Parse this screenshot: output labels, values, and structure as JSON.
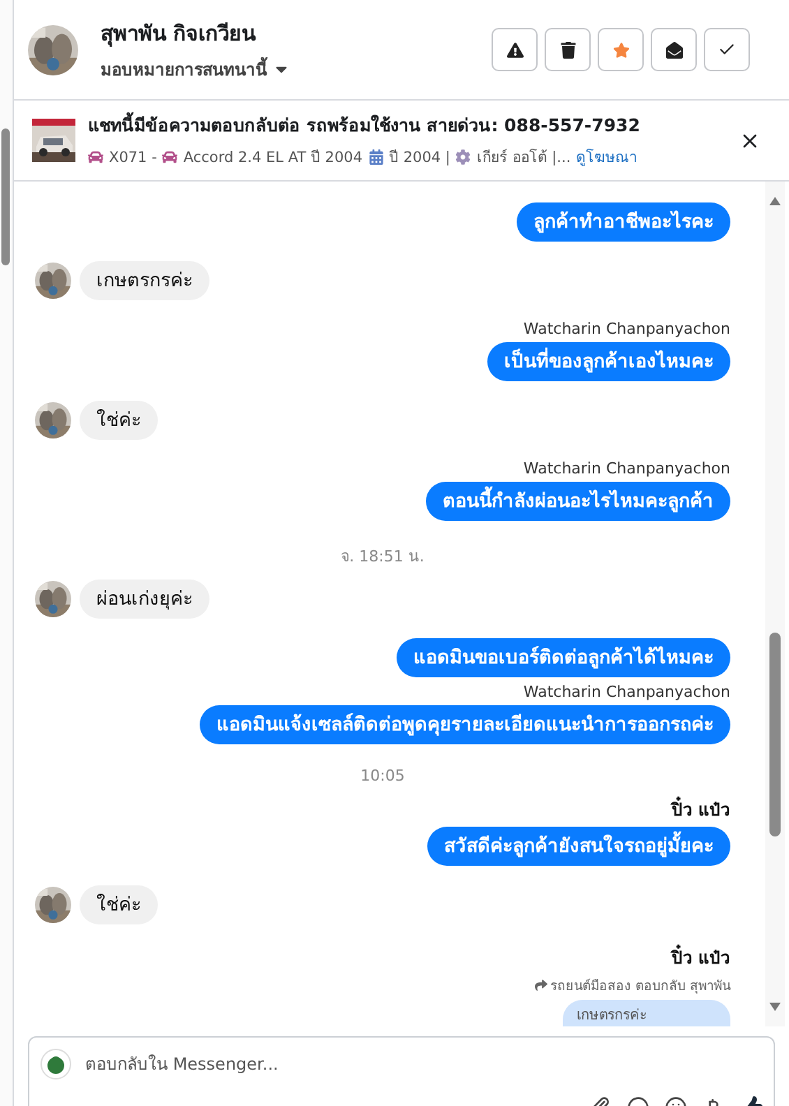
{
  "contact": {
    "name": "สุพาพัน กิจเกวียน",
    "assign_label": "มอบหมายการสนทนานี้"
  },
  "actions": [
    {
      "kind": "spam"
    },
    {
      "kind": "delete"
    },
    {
      "kind": "star",
      "on": true
    },
    {
      "kind": "unread"
    },
    {
      "kind": "done"
    }
  ],
  "ad_banner": {
    "title": "แชทนี้มีข้อความตอบกลับต่อ รถพร้อมใช้งาน สายด่วน: 088-557-7932",
    "details": [
      {
        "kind": "car",
        "text": "X071 -"
      },
      {
        "kind": "car",
        "text": "Accord 2.4 EL AT ปี 2004"
      },
      {
        "kind": "calendar",
        "text": "ปี 2004 |"
      },
      {
        "kind": "gear",
        "text": "เกียร์ ออโต้ |..."
      }
    ],
    "link": "ดูโฆษณา"
  },
  "messages": [
    {
      "kind": "out",
      "text": "ลูกค้าทำอาชีพอะไรคะ"
    },
    {
      "kind": "in",
      "text": "เกษตรกรค่ะ"
    },
    {
      "kind": "out",
      "sender": "Watcharin Chanpanyachon",
      "text": "เป็นที่ของลูกค้าเองไหมคะ"
    },
    {
      "kind": "in",
      "text": "ใช่ค่ะ"
    },
    {
      "kind": "out",
      "sender": "Watcharin Chanpanyachon",
      "text": "ตอนนี้กำลังผ่อนอะไรไหมคะลูกค้า"
    },
    {
      "kind": "time",
      "text": "จ. 18:51 น."
    },
    {
      "kind": "in",
      "text": "ผ่อนเก่งยุค่ะ"
    },
    {
      "kind": "out",
      "text": "แอดมินขอเบอร์ติดต่อลูกค้าได้ไหมคะ"
    },
    {
      "kind": "out",
      "sender": "Watcharin Chanpanyachon",
      "text": "แอดมินแจ้งเซลล์ติดต่อพูดคุยรายละเอียดแนะนำการออกรถค่ะ"
    },
    {
      "kind": "time",
      "text": "10:05"
    },
    {
      "kind": "out",
      "sender": "ปิ๋ว แป๋ว",
      "sender_bold": true,
      "text": "สวัสดีค่ะลูกค้ายังสนใจรถอยู่มั้ยคะ"
    },
    {
      "kind": "in",
      "text": "ใช่ค่ะ"
    },
    {
      "kind": "reply",
      "sender": "ปิ๋ว แป๋ว",
      "sender_bold": true,
      "note": "รถยนต์มือสอง ตอบกลับ สุพาพัน",
      "quote": "เกษตรกรค่ะ"
    }
  ],
  "composer": {
    "placeholder": "ตอบกลับใน Messenger..."
  }
}
